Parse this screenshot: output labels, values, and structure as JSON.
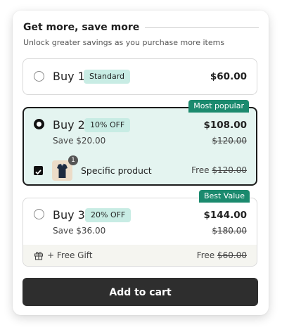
{
  "header": {
    "title": "Get more, save more",
    "subtitle": "Unlock greater savings as you purchase more items"
  },
  "options": [
    {
      "label": "Buy 1",
      "pill": "Standard",
      "price": "$60.00",
      "selected": false
    },
    {
      "label": "Buy 2",
      "pill": "10% OFF",
      "price": "$108.00",
      "save": "Save $20.00",
      "compare_price": "$120.00",
      "tag": "Most popular",
      "selected": true,
      "product": {
        "name": "Specific product",
        "badge": "1",
        "free_label": "Free",
        "free_compare": "$120.00",
        "checked": true
      }
    },
    {
      "label": "Buy 3",
      "pill": "20% OFF",
      "price": "$144.00",
      "save": "Save $36.00",
      "compare_price": "$180.00",
      "tag": "Best Value",
      "selected": false,
      "gift": {
        "label": "+ Free Gift",
        "free_label": "Free",
        "free_compare": "$60.00"
      }
    }
  ],
  "cart_button": "Add to cart",
  "colors": {
    "accent_green": "#1b8a6e",
    "pill_bg": "#c8ece4",
    "selected_bg": "#e4f4f0",
    "button_bg": "#2e2e2e"
  }
}
